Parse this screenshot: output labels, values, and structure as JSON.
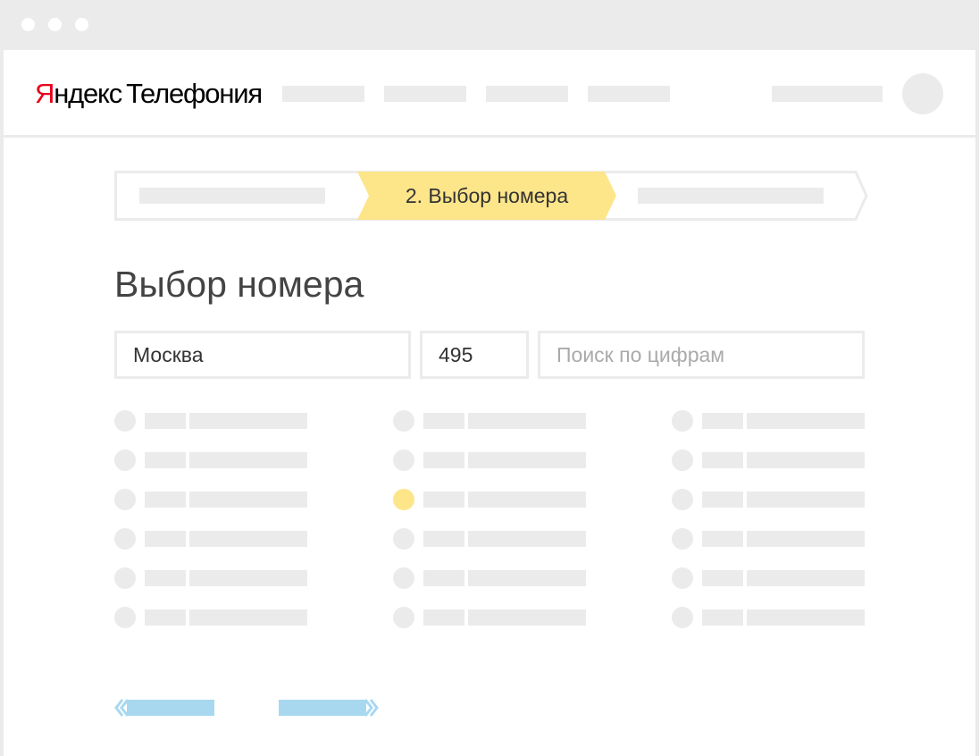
{
  "browser": {
    "dots": [
      "close",
      "minimize",
      "maximize"
    ]
  },
  "header": {
    "logo": {
      "brand_first": "Я",
      "brand_rest": "ндекс",
      "product": "Телефония"
    },
    "nav_items": [
      "placeholder",
      "placeholder",
      "placeholder",
      "placeholder"
    ],
    "user_menu": "placeholder",
    "avatar": "avatar-icon"
  },
  "stepper": {
    "steps": [
      {
        "label": "",
        "state": "done"
      },
      {
        "label": "2. Выбор номера",
        "state": "active"
      },
      {
        "label": "",
        "state": "upcoming"
      }
    ],
    "active_color": "#fde58a"
  },
  "main": {
    "title": "Выбор номера",
    "city": {
      "value": "Москва"
    },
    "code": {
      "value": "495"
    },
    "search": {
      "value": "",
      "placeholder": "Поиск по цифрам"
    }
  },
  "number_list": {
    "columns": 3,
    "rows_per_column": 6,
    "selected": {
      "column": 2,
      "row": 3
    },
    "selected_color": "#fde58a"
  },
  "pagination": {
    "prev": "prev-arrow-icon",
    "next": "next-arrow-icon",
    "color": "#a8d8f0"
  }
}
